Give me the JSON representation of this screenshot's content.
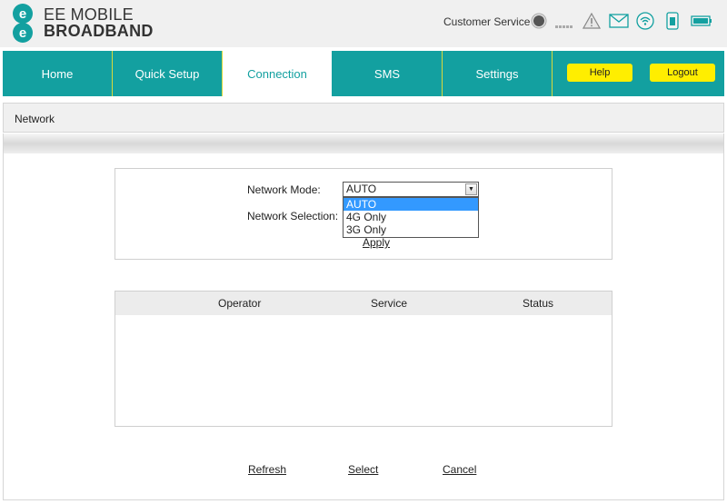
{
  "header": {
    "brand_line1": "EE MOBILE",
    "brand_line2": "BROADBAND",
    "customer_service": "Customer Service",
    "brand_color": "#13a0a0",
    "status_icons": [
      "connection-status-icon",
      "signal-strength-icon",
      "alert-icon",
      "message-icon",
      "wifi-icon",
      "sim-icon",
      "battery-icon"
    ]
  },
  "nav": {
    "tabs": [
      "Home",
      "Quick Setup",
      "Connection",
      "SMS",
      "Settings"
    ],
    "active_tab": "Connection",
    "help_label": "Help",
    "logout_label": "Logout",
    "button_color": "#ffee00"
  },
  "section": {
    "title": "Network"
  },
  "form": {
    "network_mode_label": "Network Mode:",
    "network_selection_label": "Network Selection:",
    "network_mode_value": "AUTO",
    "network_mode_options": [
      "AUTO",
      "4G Only",
      "3G Only"
    ],
    "apply_label": "Apply"
  },
  "table": {
    "columns": [
      "Operator",
      "Service",
      "Status"
    ],
    "rows": []
  },
  "actions": {
    "refresh": "Refresh",
    "select": "Select",
    "cancel": "Cancel"
  }
}
